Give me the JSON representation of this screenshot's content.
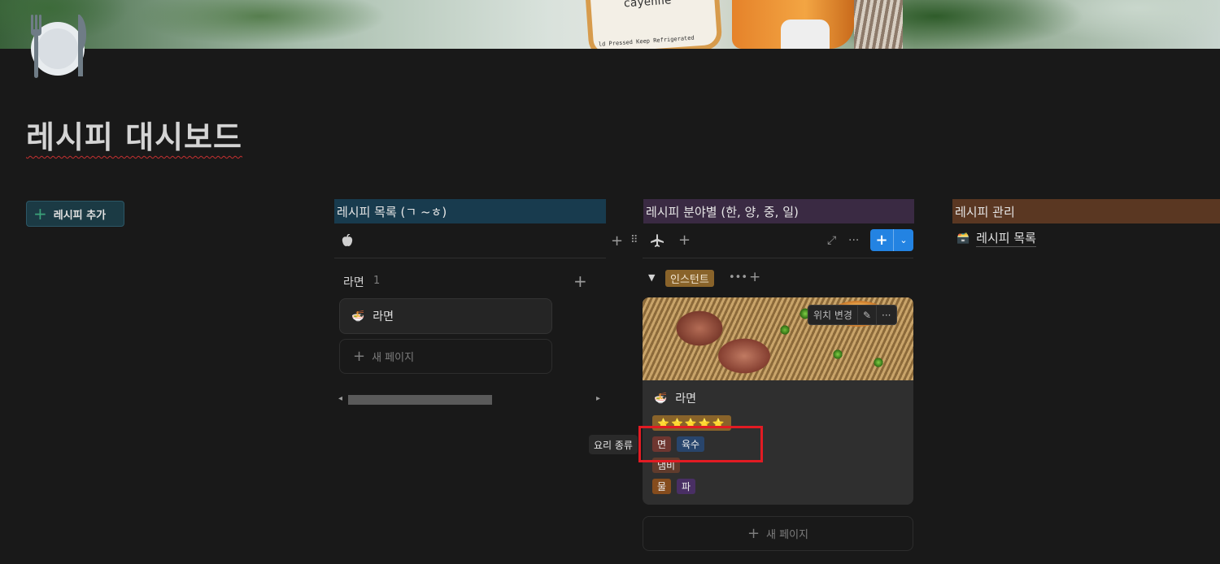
{
  "cover": {
    "bottle_text": "cayenne",
    "bottle_small_text": "ld Pressed  Keep Refrigerated"
  },
  "page": {
    "title": "레시피 대시보드"
  },
  "add_button": {
    "label": "레시피 추가"
  },
  "columns": {
    "list": {
      "header": "레시피 목록 (ㄱ ~ㅎ)",
      "group": {
        "label": "라면",
        "count": "1"
      },
      "card": {
        "emoji": "🍜",
        "title": "라면"
      },
      "new_page": "새 페이지"
    },
    "category": {
      "header": "레시피 분야별 (한, 양, 중, 일)",
      "group_tag": "인스턴트",
      "card_actions": {
        "move": "위치 변경"
      },
      "card": {
        "emoji": "🍜",
        "title": "라면",
        "stars": "⭐⭐⭐⭐⭐",
        "tags_row1": [
          "면",
          "육수"
        ],
        "tags_row2": [
          "냄비"
        ],
        "tags_row3": [
          "물",
          "파"
        ]
      },
      "tooltip": "요리 종류",
      "new_page": "새 페이지"
    },
    "management": {
      "header": "레시피 관리",
      "link": {
        "emoji": "🗃️",
        "label": "레시피 목록"
      }
    }
  },
  "colors": {
    "background": "#191919",
    "accent_blue": "#2383e2",
    "highlight_red": "#e21b23"
  }
}
